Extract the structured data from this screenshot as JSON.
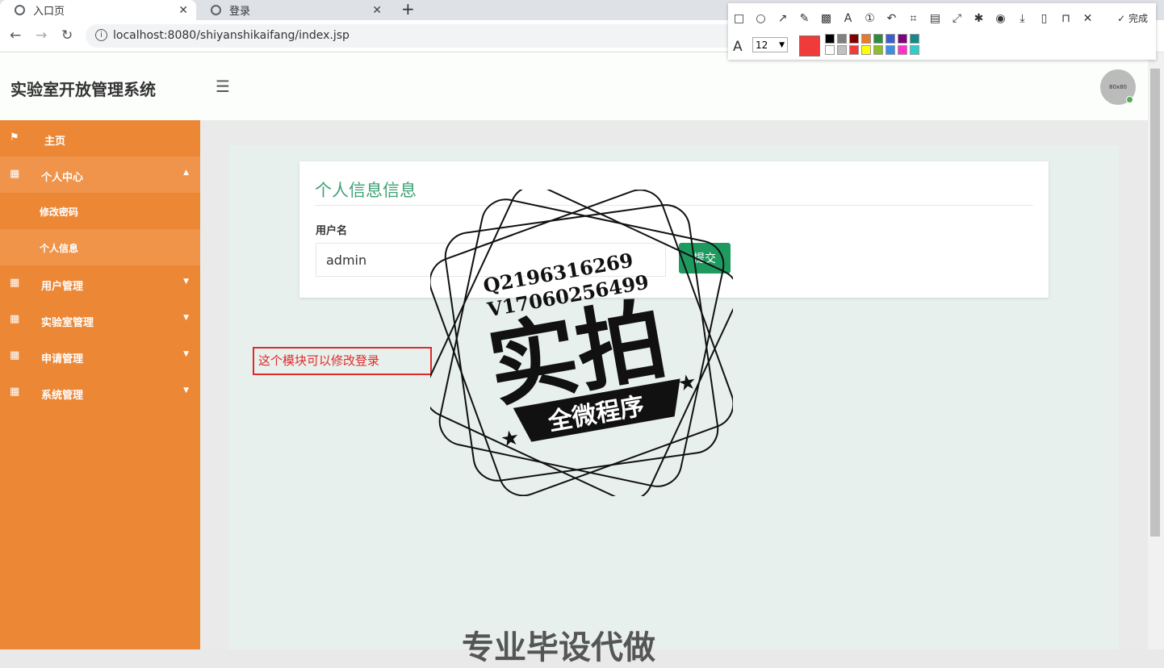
{
  "browser": {
    "tabs": [
      {
        "label": "入口页",
        "active": true
      },
      {
        "label": "登录",
        "active": false
      }
    ],
    "new_tab": "+",
    "url": "localhost:8080/shiyanshikaifang/index.jsp"
  },
  "snip_tool": {
    "done_label": "完成",
    "font_size": "12",
    "current_color": "#f13a3a",
    "palette": [
      "#000000",
      "#808080",
      "#800000",
      "#e87a2b",
      "#2e8b3d",
      "#3a5fcd",
      "#800080",
      "#138b8b",
      "#ffffff",
      "#c0c0c0",
      "#f13a3a",
      "#ffff00",
      "#8fbc2b",
      "#3a8ee6",
      "#ff33cc",
      "#33cccc"
    ]
  },
  "header": {
    "brand": "实验室开放管理系统",
    "avatar_text": "80x80"
  },
  "sidebar": {
    "items": [
      {
        "label": "主页"
      },
      {
        "label": "个人中心"
      },
      {
        "label": "修改密码"
      },
      {
        "label": "个人信息"
      },
      {
        "label": "用户管理"
      },
      {
        "label": "实验室管理"
      },
      {
        "label": "申请管理"
      },
      {
        "label": "系统管理"
      }
    ]
  },
  "card": {
    "title": "个人信息信息",
    "username_label": "用户名",
    "username_value": "admin",
    "submit_label": "提交"
  },
  "annotation_text": "这个模块可以修改登录",
  "watermark": {
    "qq": "Q2196316269",
    "wx": "V17060256499",
    "big": "实拍",
    "ribbon": "全微程序",
    "footer": "专业毕设代做"
  }
}
